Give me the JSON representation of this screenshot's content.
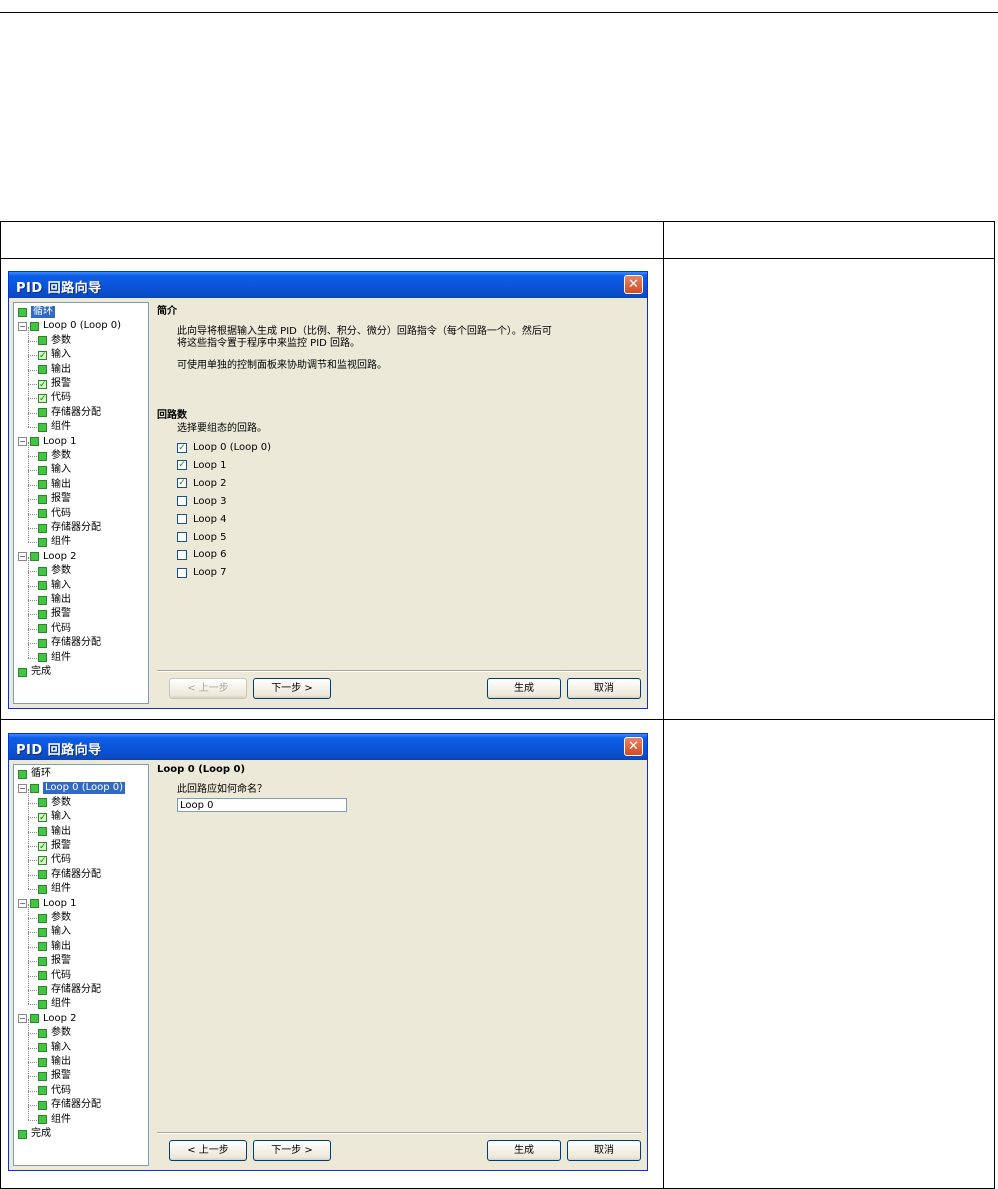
{
  "wizard1": {
    "title": "PID 回路向导",
    "tree": [
      {
        "label": "循环",
        "level": 0,
        "checked": false,
        "selected": true,
        "expander": ""
      },
      {
        "label": "Loop 0 (Loop 0)",
        "level": 1,
        "checked": false,
        "expander": "−"
      },
      {
        "label": "参数",
        "level": 2,
        "checked": false
      },
      {
        "label": "输入",
        "level": 2,
        "checked": true
      },
      {
        "label": "输出",
        "level": 2,
        "checked": false
      },
      {
        "label": "报警",
        "level": 2,
        "checked": true
      },
      {
        "label": "代码",
        "level": 2,
        "checked": true
      },
      {
        "label": "存储器分配",
        "level": 2,
        "checked": false
      },
      {
        "label": "组件",
        "level": 2,
        "checked": false
      },
      {
        "label": "Loop 1",
        "level": 1,
        "checked": false,
        "expander": "−"
      },
      {
        "label": "参数",
        "level": 2,
        "checked": false
      },
      {
        "label": "输入",
        "level": 2,
        "checked": false
      },
      {
        "label": "输出",
        "level": 2,
        "checked": false
      },
      {
        "label": "报警",
        "level": 2,
        "checked": false
      },
      {
        "label": "代码",
        "level": 2,
        "checked": false
      },
      {
        "label": "存储器分配",
        "level": 2,
        "checked": false
      },
      {
        "label": "组件",
        "level": 2,
        "checked": false
      },
      {
        "label": "Loop 2",
        "level": 1,
        "checked": false,
        "expander": "−"
      },
      {
        "label": "参数",
        "level": 2,
        "checked": false
      },
      {
        "label": "输入",
        "level": 2,
        "checked": false
      },
      {
        "label": "输出",
        "level": 2,
        "checked": false
      },
      {
        "label": "报警",
        "level": 2,
        "checked": false
      },
      {
        "label": "代码",
        "level": 2,
        "checked": false
      },
      {
        "label": "存储器分配",
        "level": 2,
        "checked": false
      },
      {
        "label": "组件",
        "level": 2,
        "checked": false
      },
      {
        "label": "完成",
        "level": 0,
        "checked": false
      }
    ],
    "intro_title": "简介",
    "intro_line1": "此向导将根据输入生成 PID（比例、积分、微分）回路指令（每个回路一个）。然后可",
    "intro_line2": "将这些指令置于程序中来监控 PID 回路。",
    "intro_line3": "可使用单独的控制面板来协助调节和监视回路。",
    "loops_title": "回路数",
    "loops_prompt": "选择要组态的回路。",
    "loops": [
      {
        "label": "Loop 0 (Loop 0)",
        "checked": true
      },
      {
        "label": "Loop 1",
        "checked": true
      },
      {
        "label": "Loop 2",
        "checked": true
      },
      {
        "label": "Loop 3",
        "checked": false
      },
      {
        "label": "Loop 4",
        "checked": false
      },
      {
        "label": "Loop 5",
        "checked": false
      },
      {
        "label": "Loop 6",
        "checked": false
      },
      {
        "label": "Loop 7",
        "checked": false
      }
    ],
    "buttons": {
      "prev": "< 上一步",
      "next": "下一步 >",
      "generate": "生成",
      "cancel": "取消"
    }
  },
  "wizard2": {
    "title": "PID 回路向导",
    "tree": [
      {
        "label": "循环",
        "level": 0,
        "checked": false,
        "expander": ""
      },
      {
        "label": "Loop 0 (Loop 0)",
        "level": 1,
        "checked": false,
        "selected": true,
        "expander": "−"
      },
      {
        "label": "参数",
        "level": 2,
        "checked": false
      },
      {
        "label": "输入",
        "level": 2,
        "checked": true
      },
      {
        "label": "输出",
        "level": 2,
        "checked": false
      },
      {
        "label": "报警",
        "level": 2,
        "checked": true
      },
      {
        "label": "代码",
        "level": 2,
        "checked": true
      },
      {
        "label": "存储器分配",
        "level": 2,
        "checked": false
      },
      {
        "label": "组件",
        "level": 2,
        "checked": false
      },
      {
        "label": "Loop 1",
        "level": 1,
        "checked": false,
        "expander": "−"
      },
      {
        "label": "参数",
        "level": 2,
        "checked": false
      },
      {
        "label": "输入",
        "level": 2,
        "checked": false
      },
      {
        "label": "输出",
        "level": 2,
        "checked": false
      },
      {
        "label": "报警",
        "level": 2,
        "checked": false
      },
      {
        "label": "代码",
        "level": 2,
        "checked": false
      },
      {
        "label": "存储器分配",
        "level": 2,
        "checked": false
      },
      {
        "label": "组件",
        "level": 2,
        "checked": false
      },
      {
        "label": "Loop 2",
        "level": 1,
        "checked": false,
        "expander": "−"
      },
      {
        "label": "参数",
        "level": 2,
        "checked": false
      },
      {
        "label": "输入",
        "level": 2,
        "checked": false
      },
      {
        "label": "输出",
        "level": 2,
        "checked": false
      },
      {
        "label": "报警",
        "level": 2,
        "checked": false
      },
      {
        "label": "代码",
        "level": 2,
        "checked": false
      },
      {
        "label": "存储器分配",
        "level": 2,
        "checked": false
      },
      {
        "label": "组件",
        "level": 2,
        "checked": false
      },
      {
        "label": "完成",
        "level": 0,
        "checked": false
      }
    ],
    "section_title": "Loop 0 (Loop 0)",
    "name_prompt": "此回路应如何命名？",
    "name_value": "Loop 0",
    "buttons": {
      "prev": "< 上一步",
      "next": "下一步 >",
      "generate": "生成",
      "cancel": "取消"
    }
  }
}
